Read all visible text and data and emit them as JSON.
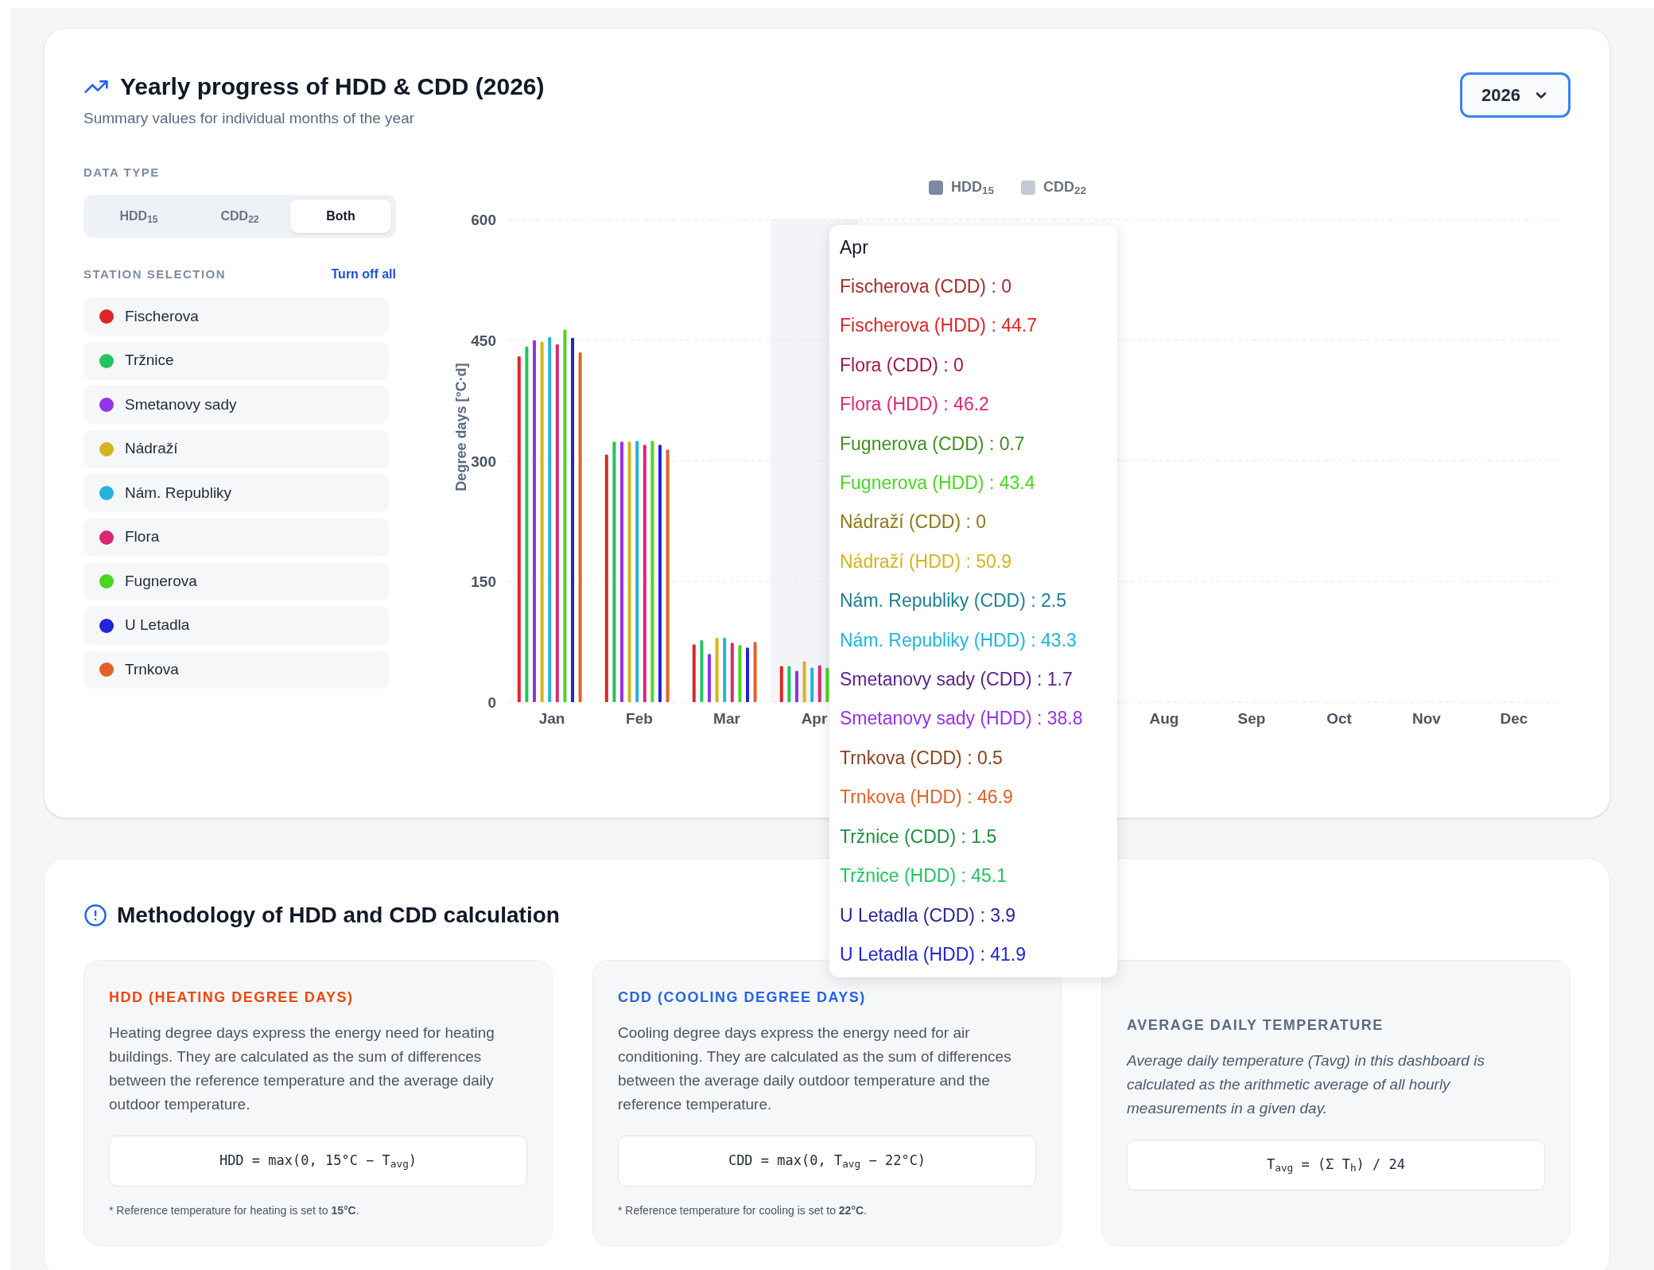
{
  "header": {
    "title": "Yearly progress of HDD & CDD (2026)",
    "subtitle": "Summary values for individual months of the year",
    "year_select": {
      "value": "2026"
    }
  },
  "controls": {
    "data_type_label": "DATA TYPE",
    "data_type_tabs": [
      {
        "label": "HDD$_{15}$",
        "selected": false
      },
      {
        "label": "CDD$_{22}$",
        "selected": false
      },
      {
        "label": "Both",
        "selected": true
      }
    ],
    "station_label": "STATION SELECTION",
    "turn_off_all": "Turn off all"
  },
  "chart": {
    "legend": [
      {
        "label": "HDD$_{15}$",
        "color": "#7b8aa0"
      },
      {
        "label": "CDD$_{22}$",
        "color": "#c4cad4"
      }
    ],
    "chart_data": {
      "type": "bar",
      "ylabel": "Degree days [°C·d]",
      "ylim": [
        0,
        600
      ],
      "yticks": [
        0,
        150,
        300,
        450,
        600
      ],
      "grid": true,
      "categories": [
        "Jan",
        "Feb",
        "Mar",
        "Apr",
        null,
        null,
        null,
        "Aug",
        "Sep",
        "Oct",
        "Nov",
        "Dec"
      ],
      "series": [
        {
          "name": "Fischerova",
          "color": "#dc2626",
          "values": [
            430,
            308,
            72,
            45,
            null,
            null,
            null,
            null,
            null,
            null,
            null,
            null
          ]
        },
        {
          "name": "Tržnice",
          "color": "#22c55e",
          "values": [
            442,
            324,
            77,
            45,
            null,
            null,
            null,
            null,
            null,
            null,
            null,
            null
          ]
        },
        {
          "name": "Smetanovy sady",
          "color": "#9333ea",
          "values": [
            450,
            324,
            60,
            39,
            null,
            null,
            null,
            null,
            null,
            null,
            null,
            null
          ]
        },
        {
          "name": "Nádraží",
          "color": "#d4b41f",
          "values": [
            448,
            324,
            80,
            51,
            null,
            null,
            null,
            null,
            null,
            null,
            null,
            null
          ]
        },
        {
          "name": "Nám. Republiky",
          "color": "#22b4d8",
          "values": [
            454,
            325,
            80,
            43,
            null,
            null,
            null,
            null,
            null,
            null,
            null,
            null
          ]
        },
        {
          "name": "Flora",
          "color": "#db2777",
          "values": [
            445,
            320,
            74,
            46,
            null,
            null,
            null,
            null,
            null,
            null,
            null,
            null
          ]
        },
        {
          "name": "Fugnerova",
          "color": "#4ad61f",
          "values": [
            463,
            325,
            71,
            43,
            null,
            null,
            null,
            null,
            null,
            null,
            null,
            null
          ]
        },
        {
          "name": "U Letadla",
          "color": "#2323d8",
          "values": [
            453,
            320,
            68,
            null,
            null,
            null,
            null,
            null,
            null,
            null,
            null,
            null
          ]
        },
        {
          "name": "Trnkova",
          "color": "#e0622a",
          "values": [
            435,
            314,
            75,
            null,
            null,
            null,
            null,
            null,
            null,
            null,
            null,
            null
          ]
        }
      ]
    },
    "hover_band": {
      "color": "#f3f4f8"
    },
    "tooltip": {
      "title": "Apr",
      "entries": [
        {
          "text": "Fischerova (CDD) : 0",
          "color": "#a52a2a"
        },
        {
          "text": "Fischerova (HDD) : 44.7",
          "color": "#dc2626"
        },
        {
          "text": "Flora (CDD) : 0",
          "color": "#9d174d"
        },
        {
          "text": "Flora (HDD) : 46.2",
          "color": "#db2777"
        },
        {
          "text": "Fugnerova (CDD) : 0.7",
          "color": "#3f8f20"
        },
        {
          "text": "Fugnerova (HDD) : 43.4",
          "color": "#4ad61f"
        },
        {
          "text": "Nádraží (CDD) : 0",
          "color": "#8a7a1a"
        },
        {
          "text": "Nádraží (HDD) : 50.9",
          "color": "#d4b41f"
        },
        {
          "text": "Nám. Republiky (CDD) : 2.5",
          "color": "#1e7f94"
        },
        {
          "text": "Nám. Republiky (HDD) : 43.3",
          "color": "#22b4d8"
        },
        {
          "text": "Smetanovy sady (CDD) : 1.7",
          "color": "#5b2590"
        },
        {
          "text": "Smetanovy sady (HDD) : 38.8",
          "color": "#9333ea"
        },
        {
          "text": "Trnkova (CDD) : 0.5",
          "color": "#8a4420"
        },
        {
          "text": "Trnkova (HDD) : 46.9",
          "color": "#e0622a"
        },
        {
          "text": "Tržnice (CDD) : 1.5",
          "color": "#1f8f3f"
        },
        {
          "text": "Tržnice (HDD) : 45.1",
          "color": "#22c55e"
        },
        {
          "text": "U Letadla (CDD) : 3.9",
          "color": "#27279a"
        },
        {
          "text": "U Letadla (HDD) : 41.9",
          "color": "#2323d8"
        }
      ]
    }
  },
  "methodology": {
    "title": "Methodology of HDD and CDD calculation",
    "cards": [
      {
        "kind": "definition",
        "title": "HDD (HEATING DEGREE DAYS)",
        "color": "#f0480a",
        "body": "Heating degree days express the energy need for heating buildings. They are calculated as the sum of differences between the reference temperature and the average daily outdoor temperature.",
        "formula": "HDD = max(0, 15°C − T$_{avg}$)",
        "footnote": "* Reference temperature for heating is set to **15°C**."
      },
      {
        "kind": "definition",
        "title": "CDD (COOLING DEGREE DAYS)",
        "color": "#2563eb",
        "body": "Cooling degree days express the energy need for air conditioning. They are calculated as the sum of differences between the average daily outdoor temperature and the reference temperature.",
        "formula": "CDD = max(0, T$_{avg}$ − 22°C)",
        "footnote": "* Reference temperature for cooling is set to **22°C**."
      },
      {
        "kind": "note",
        "title": "AVERAGE DAILY TEMPERATURE",
        "color": "#5b6b82",
        "body": "Average daily temperature (Tavg) in this dashboard is calculated as the arithmetic average of all hourly measurements in a given day.",
        "formula": "T$_{avg}$ = (Σ T$_{h}$) / 24"
      }
    ]
  }
}
